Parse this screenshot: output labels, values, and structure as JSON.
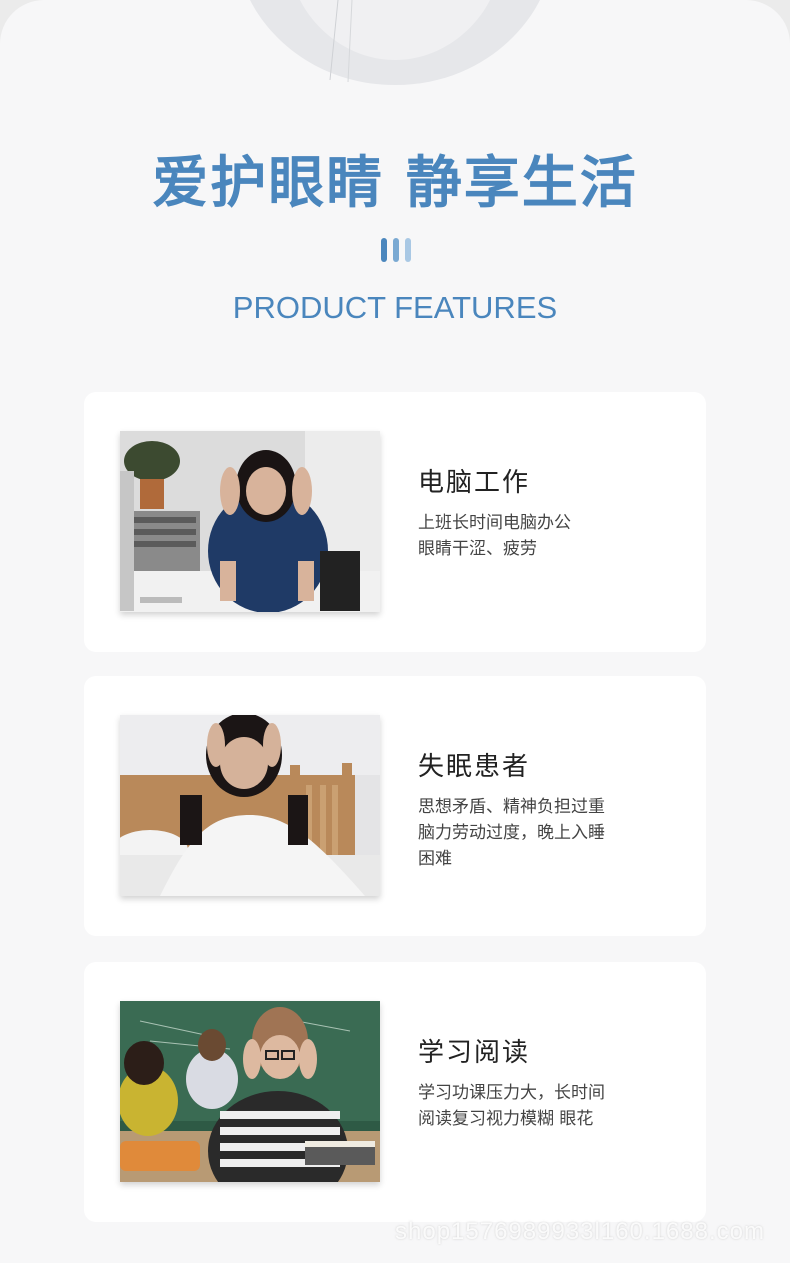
{
  "header": {
    "title": "爱护眼睛 静享生活",
    "subtitle": "PRODUCT FEATURES",
    "accent_color": "#4a86bd"
  },
  "features": [
    {
      "title": "电脑工作",
      "desc": [
        "上班长时间电脑办公",
        "眼睛干涩、疲劳"
      ],
      "image": "woman-headache-at-computer"
    },
    {
      "title": "失眠患者",
      "desc": [
        "思想矛盾、精神负担过重",
        "脑力劳动过度，晚上入睡",
        "困难"
      ],
      "image": "woman-insomnia-in-bed"
    },
    {
      "title": "学习阅读",
      "desc": [
        "学习功课压力大，长时间",
        "阅读复习视力模糊 眼花"
      ],
      "image": "student-stressed-in-classroom"
    }
  ],
  "watermark": "shop1576989933l160.1688.com"
}
